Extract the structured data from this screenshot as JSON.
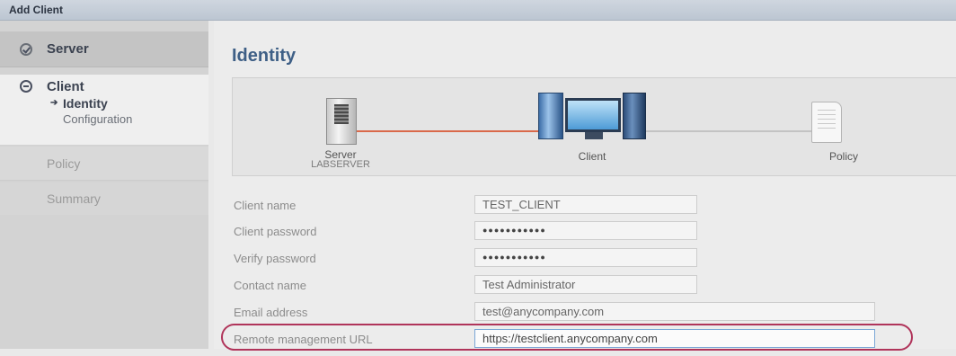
{
  "window": {
    "title": "Add Client"
  },
  "sidebar": {
    "server": "Server",
    "client": "Client",
    "client_subitems": [
      "Identity",
      "Configuration"
    ],
    "policy": "Policy",
    "summary": "Summary"
  },
  "main": {
    "heading": "Identity",
    "diagram": {
      "server_label": "Server",
      "server_name": "LABSERVER",
      "client_label": "Client",
      "policy_label": "Policy"
    },
    "form": {
      "client_name": {
        "label": "Client name",
        "value": "TEST_CLIENT"
      },
      "client_password": {
        "label": "Client password",
        "value": "●●●●●●●●●●●"
      },
      "verify_password": {
        "label": "Verify password",
        "value": "●●●●●●●●●●●"
      },
      "contact_name": {
        "label": "Contact name",
        "value": "Test Administrator"
      },
      "email_address": {
        "label": "Email address",
        "value": "test@anycompany.com"
      },
      "remote_url": {
        "label": "Remote management URL",
        "value": "https://testclient.anycompany.com"
      }
    }
  },
  "colors": {
    "heading": "#3e5f86",
    "highlight": "#b0345a",
    "connector": "#d9694a"
  },
  "icons": [
    "check-circle-icon",
    "current-step-icon",
    "arrow-bullet-icon",
    "server-icon",
    "client-computer-icon",
    "policy-document-icon"
  ]
}
